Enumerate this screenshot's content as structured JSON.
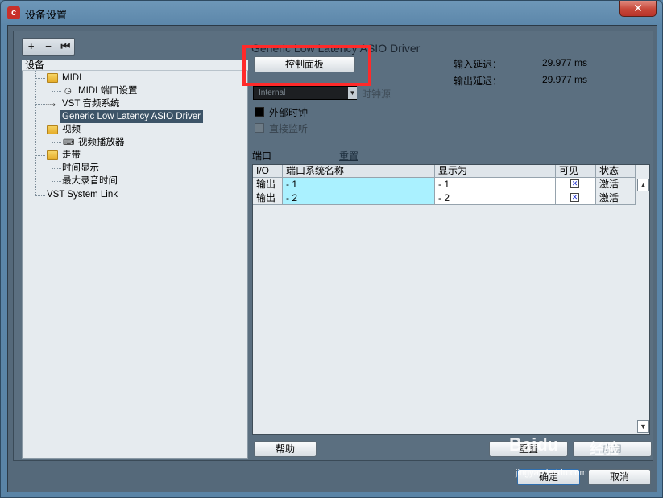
{
  "window": {
    "title": "设备设置",
    "close_glyph": "✕"
  },
  "toolbar": {
    "add": "+",
    "remove": "−",
    "reset": "⏮"
  },
  "tree": {
    "header": "设备",
    "items": [
      {
        "label": "MIDI"
      },
      {
        "label": "MIDI 端口设置"
      },
      {
        "label": "VST 音频系统"
      },
      {
        "label": "Generic Low Latency ASIO Driver"
      },
      {
        "label": "视频"
      },
      {
        "label": "视频播放器"
      },
      {
        "label": "走带"
      },
      {
        "label": "时间显示"
      },
      {
        "label": "最大录音时间"
      },
      {
        "label": "VST System Link"
      }
    ]
  },
  "driver": {
    "title": "Generic Low Latency ASIO Driver",
    "control_panel_label": "控制面板",
    "input_latency_label": "输入延迟：",
    "input_latency_value": "29.977 ms",
    "output_latency_label": "输出延迟：",
    "output_latency_value": "29.977 ms",
    "clock_source_value": "Internal",
    "clock_source_label": "时钟源",
    "external_clock_label": "外部时钟",
    "direct_monitor_label": "直接监听"
  },
  "ports": {
    "label": "端口",
    "reset_label": "重置",
    "columns": [
      "I/O",
      "端口系统名称",
      "显示为",
      "可见",
      "状态"
    ],
    "rows": [
      {
        "io": "输出",
        "system_name": "- 1",
        "display_as": "- 1",
        "visible": "✕",
        "status": "激活"
      },
      {
        "io": "输出",
        "system_name": "- 2",
        "display_as": "- 2",
        "visible": "✕",
        "status": "激活"
      }
    ]
  },
  "footer": {
    "help_label": "帮助",
    "reset_label": "重置",
    "apply_label": "应用",
    "ok_label": "确定",
    "cancel_label": "取消"
  },
  "watermark": {
    "brand": "Baidu",
    "cn": "经验",
    "url": "jingyan.baidu.com"
  },
  "colors": {
    "highlight": "#ff2a2a",
    "selected": "#3d5468",
    "cell_highlight": "#aaf1ff"
  }
}
